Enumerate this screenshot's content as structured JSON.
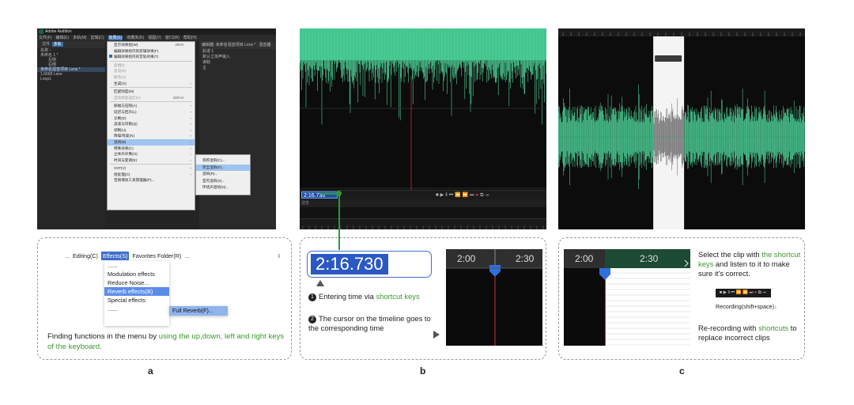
{
  "panel_a": {
    "label": "a",
    "audition": {
      "title": "Adobe Audition",
      "menubar": [
        "文件(F)",
        "编辑(E)",
        "多轨(M)",
        "剪辑(C)",
        "效果(S)",
        "收藏夹(R)",
        "视图(V)",
        "窗口(W)",
        "帮助(H)"
      ],
      "left_tabs": [
        "文件",
        "多轨"
      ],
      "left_rows": [
        "名称 ↑",
        "未命名 1 *",
        "左侧",
        "右侧",
        "未命名混音项目 Lens *",
        "1.6668 Lane",
        "Loop1"
      ],
      "effects_menu": [
        {
          "label": "显示效果组(W)",
          "shortcut": "Alt+0",
          "state": "normal"
        },
        {
          "label": "编辑效果组内的剪辑效果(F)",
          "shortcut": "",
          "state": "normal"
        },
        {
          "label": "编辑效果组内的音轨效果(T)",
          "shortcut": "",
          "state": "checked"
        },
        {
          "label": "反相(I)",
          "shortcut": "",
          "state": "disabled"
        },
        {
          "label": "反向(R)",
          "shortcut": "",
          "state": "disabled"
        },
        {
          "label": "静音(S)",
          "shortcut": "",
          "state": "disabled"
        },
        {
          "label": "生成(G)",
          "shortcut": "",
          "state": "submenu"
        },
        {
          "label": "匹配响度(M)",
          "shortcut": "",
          "state": "normal"
        },
        {
          "label": "自动修复选区(H)",
          "shortcut": "Ctrl+U",
          "state": "disabled"
        },
        {
          "label": "振幅与压限(A)",
          "shortcut": "",
          "state": "submenu"
        },
        {
          "label": "延迟与回声(L)",
          "shortcut": "",
          "state": "submenu"
        },
        {
          "label": "诊断(D)",
          "shortcut": "",
          "state": "submenu"
        },
        {
          "label": "滤波与均衡(Q)",
          "shortcut": "",
          "state": "submenu"
        },
        {
          "label": "调制(U)",
          "shortcut": "",
          "state": "submenu"
        },
        {
          "label": "降噪/恢复(N)",
          "shortcut": "",
          "state": "submenu"
        },
        {
          "label": "混响(B)",
          "shortcut": "",
          "state": "active"
        },
        {
          "label": "特殊效果(C)",
          "shortcut": "",
          "state": "submenu"
        },
        {
          "label": "立体声声像(O)",
          "shortcut": "",
          "state": "submenu"
        },
        {
          "label": "时间与变调(E)",
          "shortcut": "",
          "state": "submenu"
        },
        {
          "label": "VST(V)",
          "shortcut": "",
          "state": "submenu"
        },
        {
          "label": "批处理(G)",
          "shortcut": "",
          "state": "submenu"
        },
        {
          "label": "音频增效工具管理器(P)...",
          "shortcut": "",
          "state": "normal"
        }
      ],
      "reverb_submenu": [
        "卷积混响(C)...",
        "完全混响(F)...",
        "混响(R)...",
        "室内混响(S)...",
        "环绕声混响(N)..."
      ],
      "reverb_active_index": 1,
      "right_tab": "编辑器: 未命名混音项目 Lens *",
      "right_tab2": "混音器",
      "right_rows": [
        "轨道 1",
        "默认立体声输入",
        "读取",
        "主"
      ]
    },
    "menu_zoom": {
      "bar_items": [
        "...",
        "Editing(C)",
        "Effects(S)",
        "Favorites Folder(R)",
        "..."
      ],
      "bar_more": "⇕",
      "dropdown": [
        "......",
        "Modulation effects",
        "Reduce Noise...",
        "Reverb effects(B)",
        "Special effects",
        "......"
      ],
      "dropdown_active_index": 3,
      "submenu_item": "Full Reverb(F)...",
      "submenu_arrow": ">"
    },
    "caption_plain": "Finding functions in the menu by ",
    "caption_green": "using the up,down, left and right keys of the keyboard."
  },
  "panel_b": {
    "label": "b",
    "time_small": "2:16.730",
    "mixer_label": "混音",
    "time_big": "2:16.730",
    "step1_plain": "Entering time via ",
    "step1_green": "shortcut keys",
    "step2_text": "The cursor on the timeline goes to the corresponding time",
    "step1_num": "1",
    "step2_num": "2",
    "ruler_left": "2:00",
    "ruler_right": "2:30",
    "wave_color": "#4fd49a",
    "cursor_color": "#e03030",
    "accent_blue": "#2b59c3",
    "connector_color": "#2f9a36"
  },
  "panel_c": {
    "label": "c",
    "ruler_left": "2:00",
    "ruler_right": "2:30",
    "text1_plain_a": "Select the clip with ",
    "text1_green": "the shortcut keys",
    "text1_plain_b": " and listen to it to make sure it's correct.",
    "record_label": "Recording(shift+space)",
    "record_arrow": "↓",
    "text2_plain_a": "Re-recording with ",
    "text2_green": "shortcuts",
    "text2_plain_b": " to replace incorrect clips",
    "selected_region": {
      "start_fraction": 0.385,
      "end_fraction": 0.51
    }
  },
  "transport_glyphs": [
    "■",
    "▶",
    "‖",
    "⏮",
    "⏪",
    "⏩",
    "⏭",
    "●",
    "⧉",
    "⇥"
  ]
}
